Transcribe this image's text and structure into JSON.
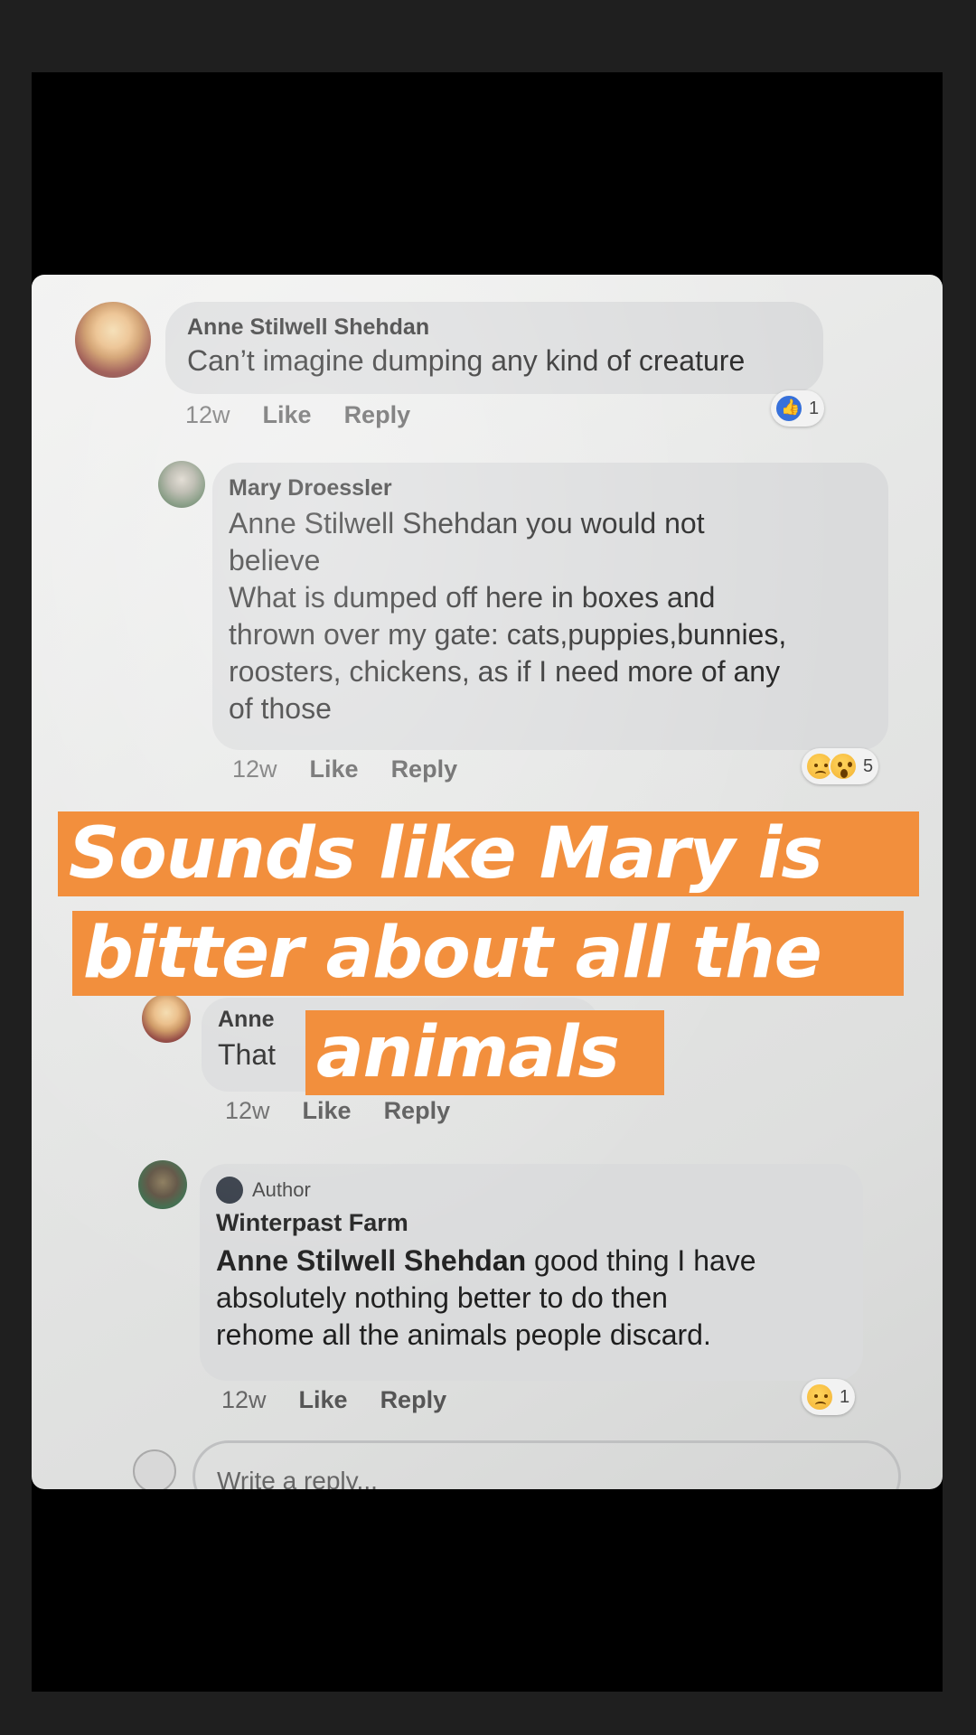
{
  "overlay": {
    "line1": "Sounds like Mary is",
    "line2": "bitter about all the",
    "line3": "animals"
  },
  "comments": [
    {
      "name": "Anne Stilwell Shehdan",
      "text": "Can’t imagine dumping any kind of creature",
      "time": "12w",
      "like": "Like",
      "reply": "Reply",
      "reactions": {
        "icons": [
          "like-icon"
        ],
        "count": "1"
      }
    },
    {
      "name": "Mary Droessler",
      "text": "Anne Stilwell Shehdan you would not\nbelieve\nWhat is dumped off here in boxes and\nthrown over my gate: cats,puppies,bunnies,\nroosters, chickens, as if I need more of any\nof those",
      "time": "12w",
      "like": "Like",
      "reply": "Reply",
      "reactions": {
        "icons": [
          "sad-icon",
          "wow-icon"
        ],
        "count": "5"
      }
    },
    {
      "name": "Anne",
      "text": "That",
      "time": "12w",
      "like": "Like",
      "reply": "Reply"
    },
    {
      "badge": "Author",
      "name": "Winterpast Farm",
      "mention": "Anne Stilwell Shehdan",
      "text": " good thing I have\nabsolutely   nothing better to do then\nrehome all the animals people discard.",
      "time": "12w",
      "like": "Like",
      "reply": "Reply",
      "reactions": {
        "icons": [
          "sad-icon"
        ],
        "count": "1"
      }
    }
  ],
  "reply_box": {
    "placeholder": "Write a reply..."
  },
  "colors": {
    "overlay_bg": "#f28f3d",
    "bubble": "#dadbdc",
    "story_bg": "#000000",
    "frame": "#1f1f1f"
  }
}
